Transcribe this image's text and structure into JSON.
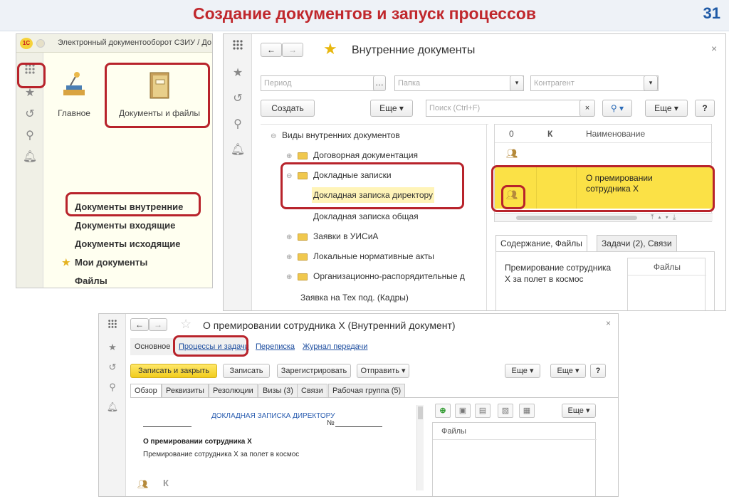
{
  "slide": {
    "title": "Создание документов и запуск процессов",
    "number": "31"
  },
  "panel1": {
    "app_title": "Электронный документооборот СЗИУ / До",
    "logo_text": "1С",
    "tiles": [
      {
        "label": "Главное"
      },
      {
        "label": "Документы и файлы"
      }
    ],
    "menu": [
      "Документы внутренние",
      "Документы входящие",
      "Документы исходящие",
      "Мои документы",
      "Файлы"
    ],
    "favorite_star": "★"
  },
  "panel2": {
    "window_title": "Внутренние документы",
    "filters": {
      "period": "Период",
      "folder": "Папка",
      "counterparty": "Контрагент"
    },
    "toolbar": {
      "create": "Создать",
      "more1": "Еще",
      "search": "Поиск (Ctrl+F)",
      "more2": "Еще",
      "help": "?"
    },
    "tree": {
      "root": "Виды внутренних документов",
      "items": [
        {
          "label": "Договорная документация",
          "kind": "folder"
        },
        {
          "label": "Докладные записки",
          "kind": "folder"
        },
        {
          "label": "Докладная записка директору",
          "kind": "item-selected"
        },
        {
          "label": "Докладная записка общая",
          "kind": "item"
        },
        {
          "label": "Заявки в УИСиА",
          "kind": "folder"
        },
        {
          "label": "Локальные нормативные акты",
          "kind": "folder"
        },
        {
          "label": "Организационно-распорядительные д",
          "kind": "folder"
        },
        {
          "label": "Заявка на Тех под. (Кадры)",
          "kind": "item"
        }
      ]
    },
    "grid": {
      "headers": {
        "attach": "0",
        "k": "К",
        "name": "Наименование"
      },
      "selected_row": "О премировании сотрудника Х"
    },
    "tabs": [
      "Содержание, Файлы",
      "Задачи (2), Связи"
    ],
    "content_text": "Премирование сотрудника Х за полет в космос",
    "files_header": "Файлы"
  },
  "panel3": {
    "window_title": "О премировании сотрудника Х (Внутренний документ)",
    "nav": {
      "main": "Основное",
      "processes": "Процессы и задачи",
      "mail": "Переписка",
      "journal": "Журнал передачи"
    },
    "toolbar": {
      "save_close": "Записать и закрыть",
      "save": "Записать",
      "register": "Зарегистрировать",
      "send": "Отправить",
      "more1": "Еще",
      "more2": "Еще",
      "help": "?"
    },
    "tabs": [
      "Обзор",
      "Реквизиты",
      "Резолюции",
      "Визы (3)",
      "Связи",
      "Рабочая группа (5)"
    ],
    "doc": {
      "heading": "ДОКЛАДНАЯ ЗАПИСКА ДИРЕКТОРУ",
      "number_label": "№",
      "subject": "О премировании сотрудника Х",
      "body": "Премирование сотрудника Х за полет в космос",
      "k": "К"
    },
    "files": {
      "more": "Еще",
      "header": "Файлы"
    }
  }
}
